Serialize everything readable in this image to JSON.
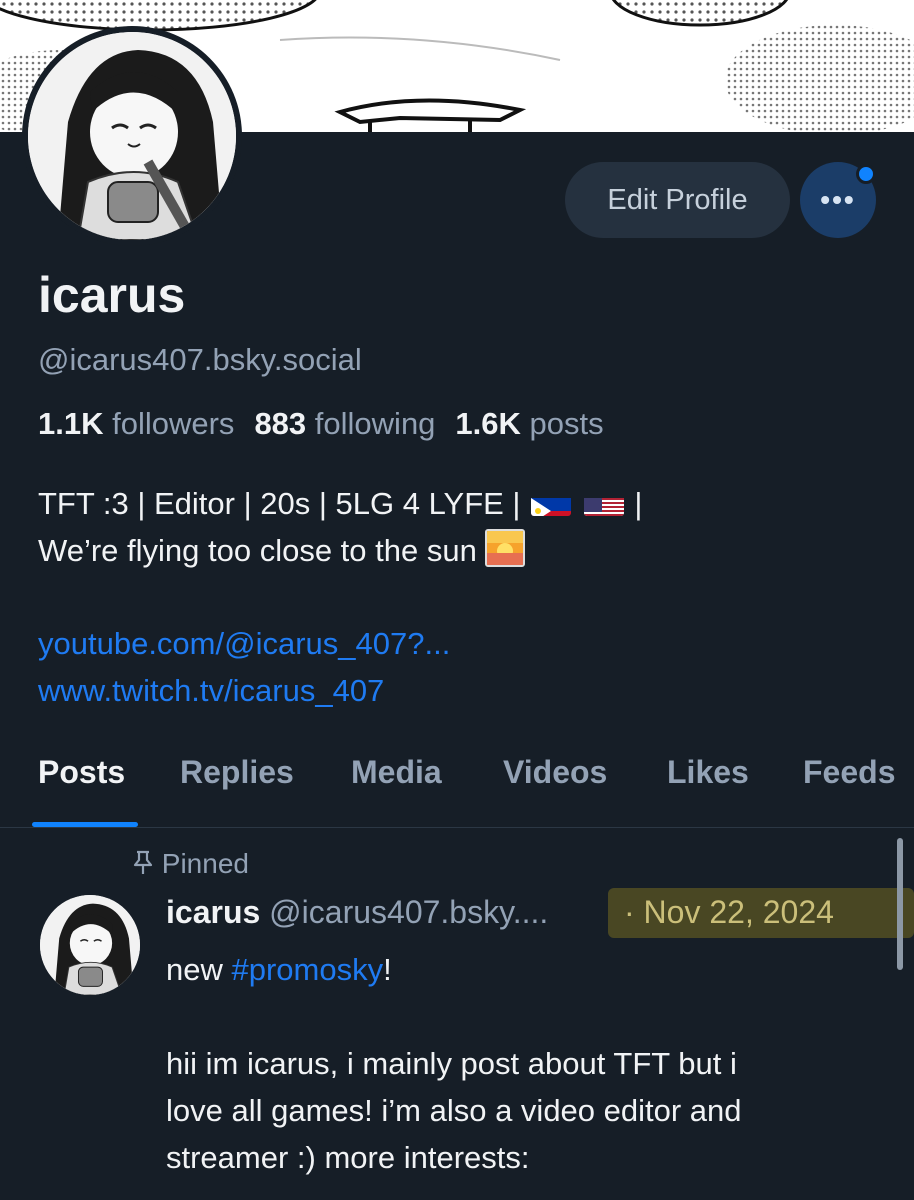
{
  "profile": {
    "display_name": "icarus",
    "handle": "@icarus407.bsky.social",
    "edit_label": "Edit Profile",
    "more_label": "•••",
    "stats": {
      "followers_count": "1.1K",
      "followers_label": "followers",
      "following_count": "883",
      "following_label": "following",
      "posts_count": "1.6K",
      "posts_label": "posts"
    },
    "bio_line1": "TFT :3 | Editor | 20s | 5LG 4 LYFE |",
    "bio_line1_end": "|",
    "bio_line2": "We’re flying too close to the sun",
    "links": [
      "youtube.com/@icarus_407?...",
      "www.twitch.tv/icarus_407"
    ]
  },
  "tabs": [
    "Posts",
    "Replies",
    "Media",
    "Videos",
    "Likes",
    "Feeds"
  ],
  "active_tab": "Posts",
  "post": {
    "pinned_label": "Pinned",
    "author": "icarus",
    "handle": "@icarus407.bsky....",
    "date": "· Nov 22, 2024",
    "line1_prefix": "new ",
    "hashtag": "#promosky",
    "line1_suffix": "!",
    "line2": "hii im icarus, i mainly post about TFT but i",
    "line3": "love all games! i’m also a video editor and",
    "line4": "streamer :) more interests:"
  },
  "icons": {
    "pin": "pin-icon",
    "more": "ellipsis-icon",
    "flags": [
      "philippines-flag-icon",
      "usa-flag-icon"
    ],
    "sunset": "sunrise-emoji-icon"
  },
  "colors": {
    "background": "#161e27",
    "accent": "#1083fe",
    "link": "#1f7bf2",
    "muted": "#93a2b5",
    "highlight": "#a8941e"
  }
}
